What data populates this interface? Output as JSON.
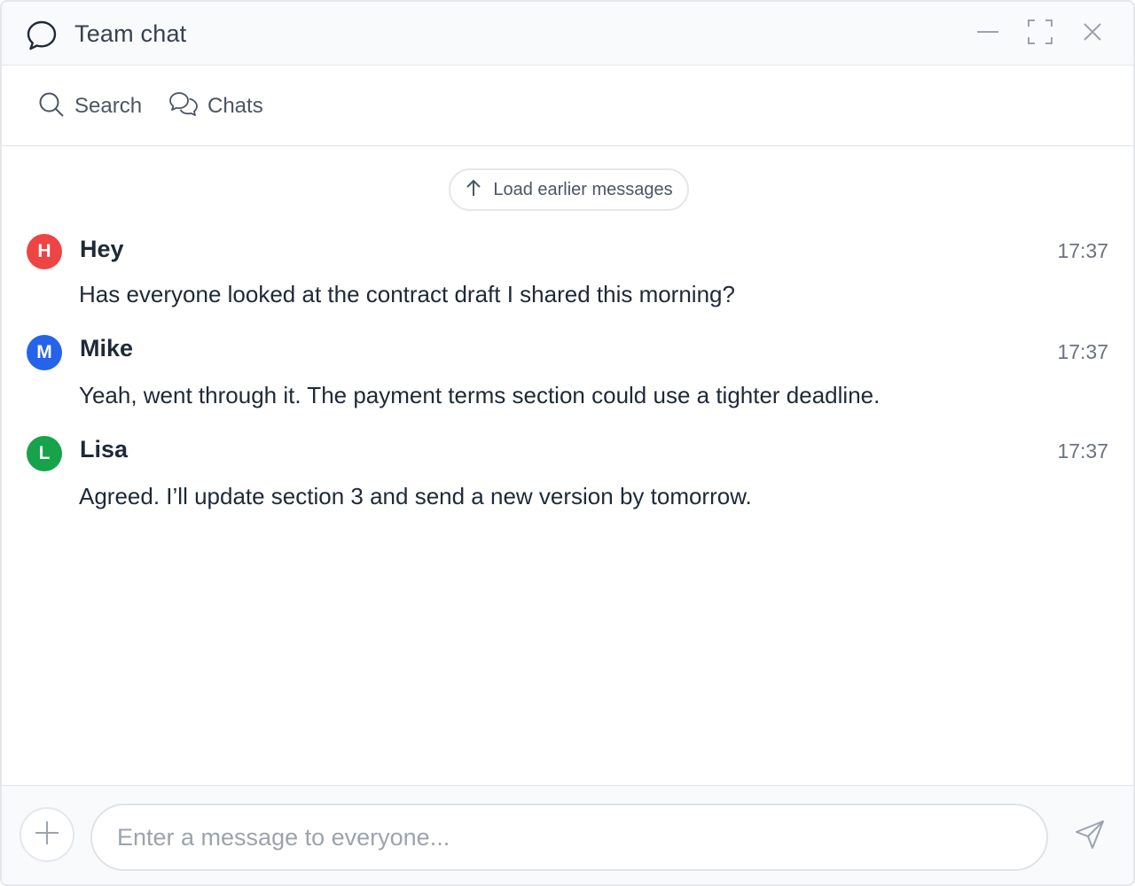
{
  "window": {
    "title": "Team chat",
    "icon": "chat-bubble-icon",
    "controls": [
      "minimize-icon",
      "maximize-icon",
      "close-icon"
    ]
  },
  "toolbar": {
    "search_label": "Search",
    "search_icon": "search-icon",
    "chats_label": "Chats",
    "chats_icon": "chats-icon"
  },
  "messages_area": {
    "load_earlier_label": "Load earlier messages",
    "load_earlier_icon": "arrow-up-icon"
  },
  "messages": [
    {
      "initial": "H",
      "sender": "Hey",
      "time": "17:37",
      "text": "Has everyone looked at the contract draft I shared this morning?",
      "avatar_color": "#ef4444"
    },
    {
      "initial": "M",
      "sender": "Mike",
      "time": "17:37",
      "text": "Yeah, went through it. The payment terms section could use a tighter deadline.",
      "avatar_color": "#2563eb"
    },
    {
      "initial": "L",
      "sender": "Lisa",
      "time": "17:37",
      "text": "Agreed. I’ll update section 3 and send a new version by tomorrow.",
      "avatar_color": "#16a34a"
    }
  ],
  "composer": {
    "placeholder": "Enter a message to everyone...",
    "value": "",
    "attach_icon": "plus-icon",
    "send_icon": "send-icon"
  }
}
